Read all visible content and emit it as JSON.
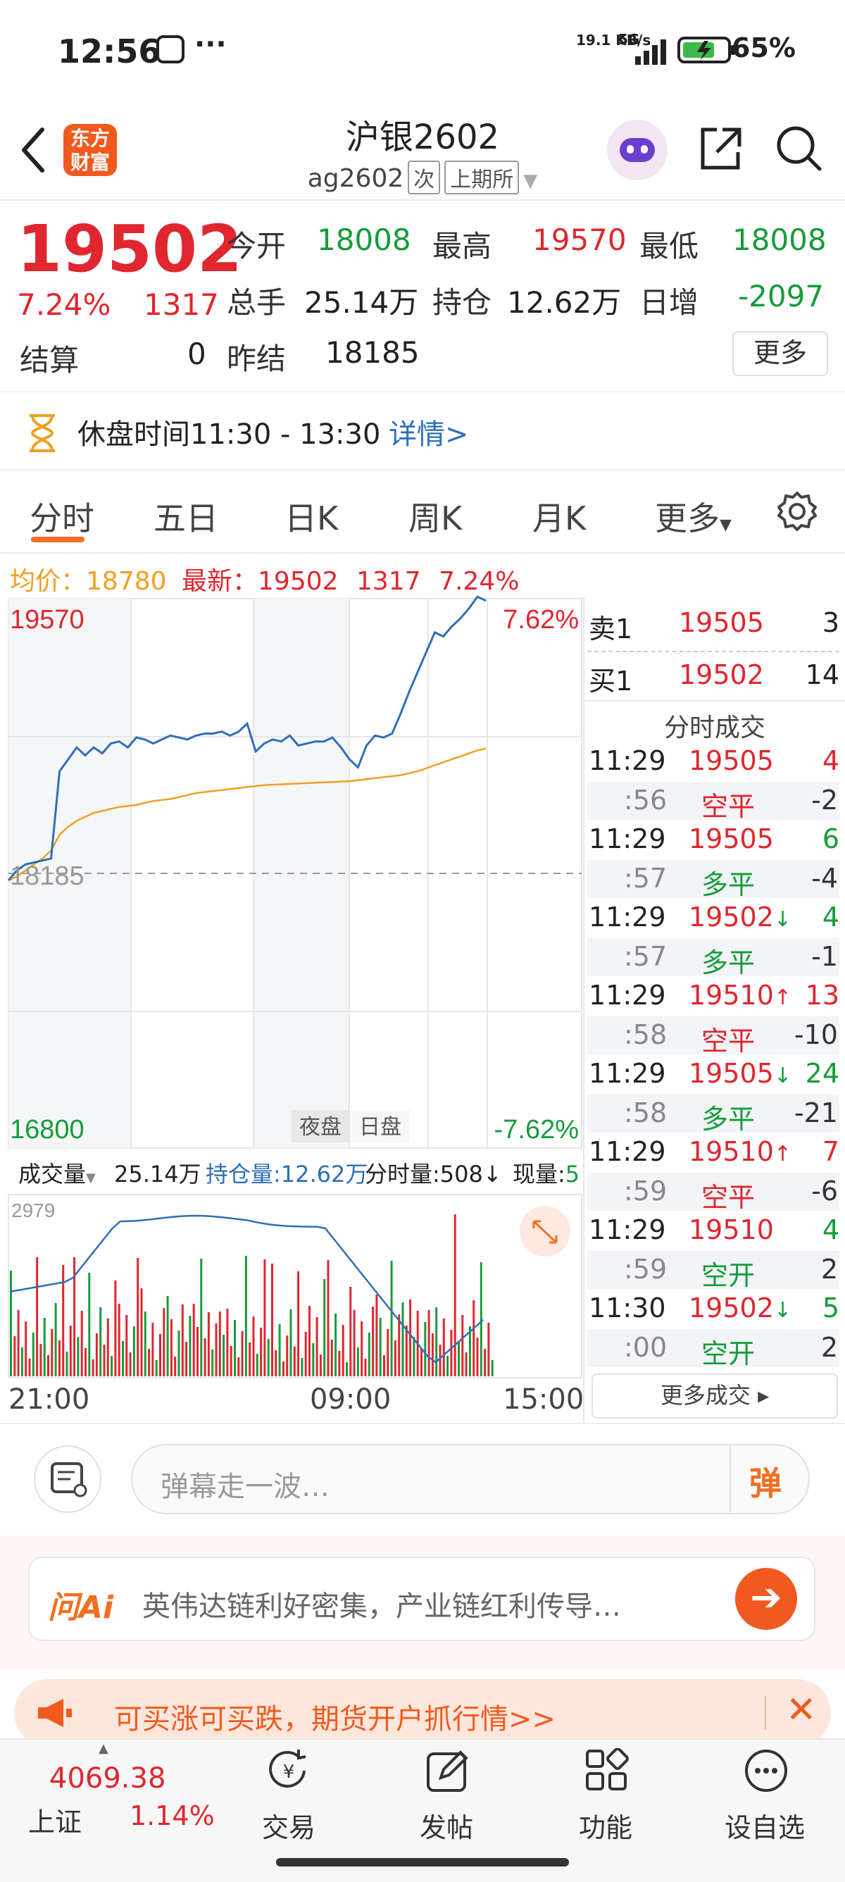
{
  "status_bar": {
    "time": "12:56",
    "net_speed": "19.1 KB/s",
    "net_type": "5G",
    "battery": "65%"
  },
  "header": {
    "logo": "东方财富",
    "title": "沪银2602",
    "code": "ag2602",
    "tag1": "次",
    "tag2": "上期所"
  },
  "quote": {
    "price": "19502",
    "change_pct": "7.24%",
    "change": "1317",
    "open_label": "今开",
    "open": "18008",
    "high_label": "最高",
    "high": "19570",
    "low_label": "最低",
    "low": "18008",
    "vol_label": "总手",
    "vol": "25.14万",
    "oi_label": "持仓",
    "oi": "12.62万",
    "oi_chg_label": "日增",
    "oi_chg": "-2097",
    "settle_label": "结算",
    "settle": "0",
    "prev_settle_label": "昨结",
    "prev_settle": "18185",
    "more": "更多"
  },
  "notice": {
    "text": "休盘时间11:30 - 13:30",
    "link": "详情>"
  },
  "tabs": [
    "分时",
    "五日",
    "日K",
    "周K",
    "月K",
    "更多"
  ],
  "info_line": {
    "avg_label": "均价：",
    "avg": "18780",
    "latest_label": "最新：",
    "latest": "19502",
    "chg": "1317",
    "pct": "7.24%"
  },
  "chart_data": {
    "type": "line",
    "ylim": [
      16800,
      19570
    ],
    "ytick_left_top": "19570",
    "ytick_left_mid": "18185",
    "ytick_left_bottom": "16800",
    "ytick_right_top": "7.62%",
    "ytick_right_bottom": "-7.62%",
    "xticks": [
      "21:00",
      "09:00",
      "15:00"
    ],
    "session_labels": [
      "夜盘",
      "日盘"
    ],
    "prev_settle": 18185,
    "series": [
      {
        "values": [
          18150,
          18200,
          18230,
          18240,
          18250,
          18260,
          18700,
          18760,
          18820,
          18780,
          18820,
          18790,
          18840,
          18850,
          18820,
          18870,
          18860,
          18840,
          18860,
          18880,
          18870,
          18860,
          18880,
          18890,
          18890,
          18900,
          18880,
          18900,
          18940,
          18800,
          18840,
          18860,
          18850,
          18880,
          18830,
          18840,
          18850,
          18850,
          18870,
          18820,
          18760,
          18720,
          18830,
          18880,
          18870,
          18890,
          18990,
          19100,
          19200,
          19300,
          19400,
          19380,
          19430,
          19470,
          19520,
          19580,
          19560
        ]
      },
      {
        "values": [
          18150,
          18170,
          18200,
          18230,
          18260,
          18300,
          18380,
          18420,
          18450,
          18470,
          18490,
          18500,
          18510,
          18520,
          18525,
          18530,
          18540,
          18550,
          18555,
          18560,
          18570,
          18580,
          18590,
          18595,
          18600,
          18605,
          18610,
          18615,
          18620,
          18625,
          18630,
          18632,
          18634,
          18636,
          18638,
          18640,
          18642,
          18644,
          18646,
          18648,
          18650,
          18655,
          18660,
          18665,
          18670,
          18675,
          18680,
          18690,
          18700,
          18715,
          18730,
          18745,
          18760,
          18775,
          18790,
          18805,
          18815
        ]
      }
    ],
    "volume": {
      "label": "成交量",
      "total": "25.14万",
      "oi_label": "持仓量:12.62万",
      "tick_label": "分时量:508↓",
      "now_label": "现量:5",
      "ymax_label": "2979"
    }
  },
  "order_book": {
    "sell": {
      "label": "卖1",
      "price": "19505",
      "qty": "3"
    },
    "buy": {
      "label": "买1",
      "price": "19502",
      "qty": "14"
    }
  },
  "trades_title": "分时成交",
  "trades": [
    {
      "time": "11:29",
      "price": "19505",
      "arrow": "",
      "qty": "4",
      "sec": ":56",
      "type": "空平",
      "chg": "-2",
      "pc": "red",
      "tc": "red"
    },
    {
      "time": "11:29",
      "price": "19505",
      "arrow": "",
      "qty": "6",
      "sec": ":57",
      "type": "多平",
      "chg": "-4",
      "pc": "red",
      "tc": "green"
    },
    {
      "time": "11:29",
      "price": "19502",
      "arrow": "↓",
      "qty": "4",
      "sec": ":57",
      "type": "多平",
      "chg": "-1",
      "pc": "red",
      "tc": "green"
    },
    {
      "time": "11:29",
      "price": "19510",
      "arrow": "↑",
      "qty": "13",
      "sec": ":58",
      "type": "空平",
      "chg": "-10",
      "pc": "red",
      "tc": "red"
    },
    {
      "time": "11:29",
      "price": "19505",
      "arrow": "↓",
      "qty": "24",
      "sec": ":58",
      "type": "多平",
      "chg": "-21",
      "pc": "red",
      "tc": "green"
    },
    {
      "time": "11:29",
      "price": "19510",
      "arrow": "↑",
      "qty": "7",
      "sec": ":59",
      "type": "空平",
      "chg": "-6",
      "pc": "red",
      "tc": "red"
    },
    {
      "time": "11:29",
      "price": "19510",
      "arrow": "",
      "qty": "4",
      "sec": ":59",
      "type": "空开",
      "chg": "2",
      "pc": "red",
      "tc": "green"
    },
    {
      "time": "11:30",
      "price": "19502",
      "arrow": "↓",
      "qty": "5",
      "sec": ":00",
      "type": "空开",
      "chg": "2",
      "pc": "red",
      "tc": "green"
    }
  ],
  "more_trades": "更多成交",
  "danmaku": {
    "placeholder": "弹幕走一波…",
    "button": "弹"
  },
  "ai": {
    "logo": "问Ai",
    "text": "英伟达链利好密集，产业链红利传导…"
  },
  "promo": {
    "text": "可买涨可买跌，期货开户抓行情>>"
  },
  "bottom_nav": {
    "index_value": "4069.38",
    "index_name": "上证",
    "index_pct": "1.14%",
    "items": [
      "交易",
      "发帖",
      "功能",
      "设自选"
    ]
  }
}
